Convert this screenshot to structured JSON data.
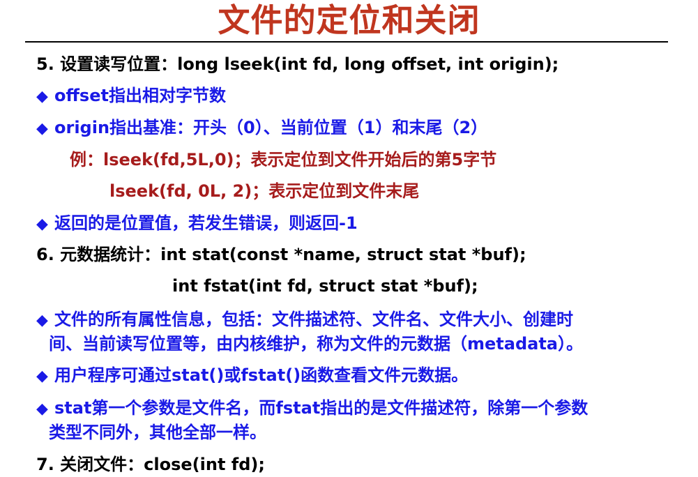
{
  "slide": {
    "title": "文件的定位和关闭",
    "lines": [
      {
        "id": "l1",
        "text": "5. 设置读写位置：long lseek(int fd, long offset, int origin);"
      },
      {
        "id": "l2",
        "bullet": "◆",
        "text": "offset指出相对字节数"
      },
      {
        "id": "l3",
        "bullet": "◆",
        "text": "origin指出基准：开头（0）、当前位置（1）和末尾（2）"
      },
      {
        "id": "l4",
        "text": "例：lseek(fd,5L,0)；表示定位到文件开始后的第5字节"
      },
      {
        "id": "l5",
        "text": "lseek(fd, 0L, 2)；表示定位到文件末尾"
      },
      {
        "id": "l6",
        "bullet": "◆",
        "text": "返回的是位置值，若发生错误，则返回-1"
      },
      {
        "id": "l7",
        "text": "6. 元数据统计：int stat(const *name, struct stat *buf);"
      },
      {
        "id": "l8",
        "text": "int fstat(int fd, struct stat *buf);"
      },
      {
        "id": "l9",
        "bullet": "◆",
        "text": "文件的所有属性信息，包括：文件描述符、文件名、文件大小、创建时"
      },
      {
        "id": "l10",
        "text": "间、当前读写位置等，由内核维护，称为文件的元数据（metadata）。"
      },
      {
        "id": "l11",
        "bullet": "◆",
        "text": "用户程序可通过stat()或fstat()函数查看文件元数据。"
      },
      {
        "id": "l12",
        "bullet": "◆",
        "text": "stat第一个参数是文件名，而fstat指出的是文件描述符，除第一个参数"
      },
      {
        "id": "l13",
        "text": "类型不同外，其他全部一样。"
      },
      {
        "id": "l14",
        "text": "7. 关闭文件：close(int fd);"
      }
    ]
  },
  "colors": {
    "title": "#c0361f",
    "heading": "#000000",
    "bullet_text": "#1a1ae6",
    "example_text": "#a61c1c"
  }
}
